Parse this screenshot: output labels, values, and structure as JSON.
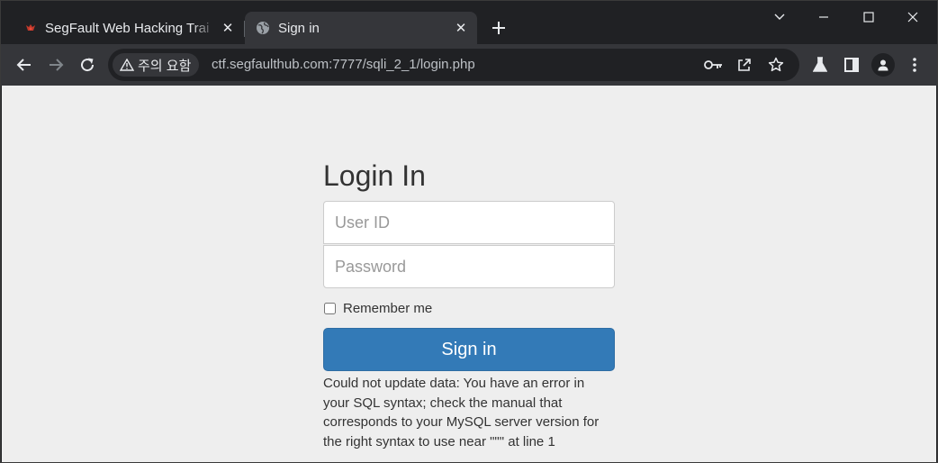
{
  "browser": {
    "tabs": [
      {
        "title": "SegFault Web Hacking Trai",
        "active": false,
        "icon": "segfault-favicon"
      },
      {
        "title": "Sign in",
        "active": true,
        "icon": "globe-icon"
      }
    ],
    "security_chip": "주의 요함",
    "url": "ctf.segfaulthub.com:7777/sqli_2_1/login.php"
  },
  "form": {
    "heading": "Login In",
    "user_placeholder": "User ID",
    "password_placeholder": "Password",
    "remember_label": "Remember me",
    "submit_label": "Sign in",
    "error_lines": [
      "Could not update data: You have an error in",
      "your SQL syntax; check the manual that",
      "corresponds to your MySQL server version for",
      "the right syntax to use near \"\"\" at line 1"
    ]
  },
  "colors": {
    "tabstrip_bg": "#202124",
    "toolbar_bg": "#35363a",
    "page_bg": "#eeeeee",
    "button_primary": "#337ab7"
  }
}
